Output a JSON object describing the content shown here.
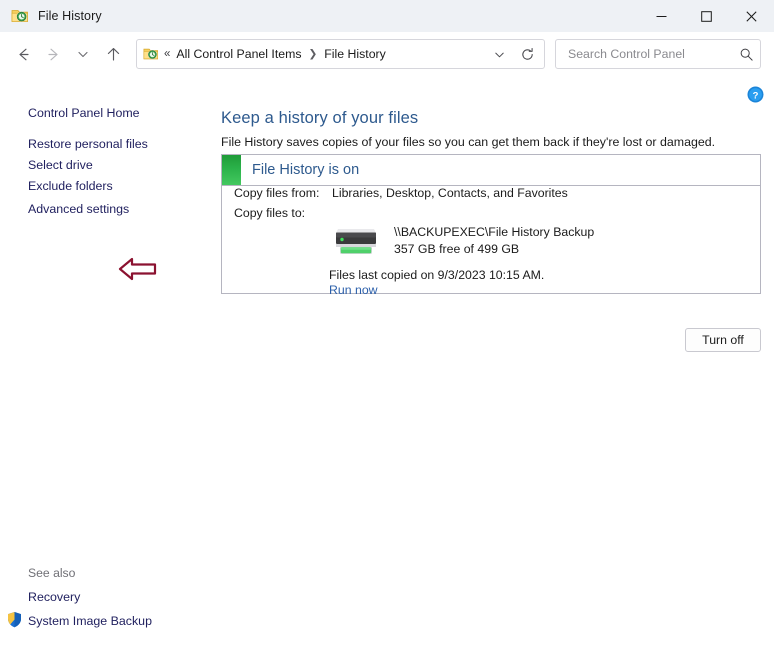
{
  "window": {
    "title": "File History",
    "icon": "file-history-folder-icon",
    "controls": {
      "minimize": "─",
      "maximize": "□",
      "close": "✕"
    }
  },
  "navigation": {
    "back_icon": "back-arrow-icon",
    "forward_icon": "forward-arrow-icon",
    "recent_icon": "recent-locations-chevron-icon",
    "up_icon": "up-arrow-icon",
    "address": {
      "icon": "file-history-folder-icon",
      "overflow": "«",
      "segments": [
        "All Control Panel Items",
        "File History"
      ],
      "separator": "❯",
      "dropdown_icon": "chevron-down-icon",
      "refresh_icon": "refresh-icon"
    },
    "search": {
      "placeholder": "Search Control Panel",
      "value": "",
      "icon": "search-icon"
    }
  },
  "sidebar": {
    "home_label": "Control Panel Home",
    "items": [
      {
        "label": "Restore personal files"
      },
      {
        "label": "Select drive"
      },
      {
        "label": "Exclude folders"
      },
      {
        "label": "Advanced settings"
      }
    ],
    "see_also_label": "See also",
    "see_also": [
      {
        "label": "Recovery",
        "icon": null
      },
      {
        "label": "System Image Backup",
        "icon": "uac-shield-icon"
      }
    ]
  },
  "annotation": {
    "arrow": "left-pointing-arrow",
    "color": "#8b1230",
    "points_at": "Exclude folders"
  },
  "main": {
    "help_icon": "help-question-icon",
    "heading": "Keep a history of your files",
    "subheading": "File History saves copies of your files so you can get them back if they're lost or damaged.",
    "status": {
      "indicator_color": "#2bb24a",
      "title": "File History is on",
      "rows": [
        {
          "label": "Copy files from:",
          "value": "Libraries, Desktop, Contacts, and Favorites"
        },
        {
          "label": "Copy files to:",
          "value": ""
        }
      ],
      "drive": {
        "icon": "external-hard-drive-icon",
        "name": "\\\\BACKUPEXEC\\File History Backup",
        "free_space": "357 GB free of 499 GB"
      },
      "last_copied": "Files last copied on 9/3/2023 10:15 AM.",
      "run_now_label": "Run now"
    },
    "turn_off_label": "Turn off"
  },
  "colors": {
    "titlebar_bg": "#eef1f5",
    "heading_blue": "#2e5a8e",
    "link_navy": "#1f1f5e",
    "link_blue": "#2b5faa",
    "status_green": "#2bb24a",
    "annotation_maroon": "#8b1230",
    "panel_border": "#b5b5c0"
  }
}
